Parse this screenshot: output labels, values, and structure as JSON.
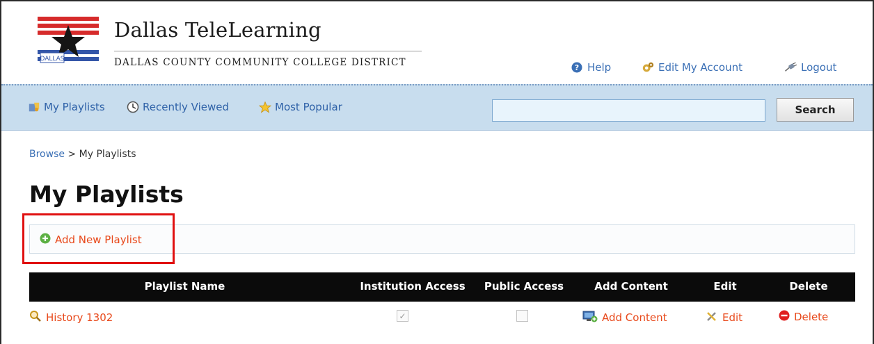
{
  "brand": {
    "title": "Dallas TeleLearning",
    "subtitle": "DALLAS COUNTY COMMUNITY COLLEGE DISTRICT",
    "logo_text": "DALLAS"
  },
  "toplinks": {
    "help": "Help",
    "edit_account": "Edit My Account",
    "logout": "Logout"
  },
  "nav": {
    "my_playlists": "My Playlists",
    "recently_viewed": "Recently Viewed",
    "most_popular": "Most Popular",
    "search_value": "",
    "search_button": "Search"
  },
  "breadcrumb": {
    "browse": "Browse",
    "separator": " > ",
    "current": "My Playlists"
  },
  "page": {
    "title": "My Playlists",
    "add_new": "Add New Playlist"
  },
  "table": {
    "headers": [
      "Playlist Name",
      "Institution Access",
      "Public Access",
      "Add Content",
      "Edit",
      "Delete"
    ],
    "rows": [
      {
        "name": "History 1302",
        "institution_access": true,
        "public_access": false,
        "add_content": "Add Content",
        "edit": "Edit",
        "delete": "Delete"
      }
    ]
  },
  "colors": {
    "link_blue": "#3a6fb5",
    "link_orange": "#e8481a",
    "nav_bg": "#c8ddee",
    "table_header_bg": "#0b0b0b",
    "highlight": "#e01010"
  }
}
